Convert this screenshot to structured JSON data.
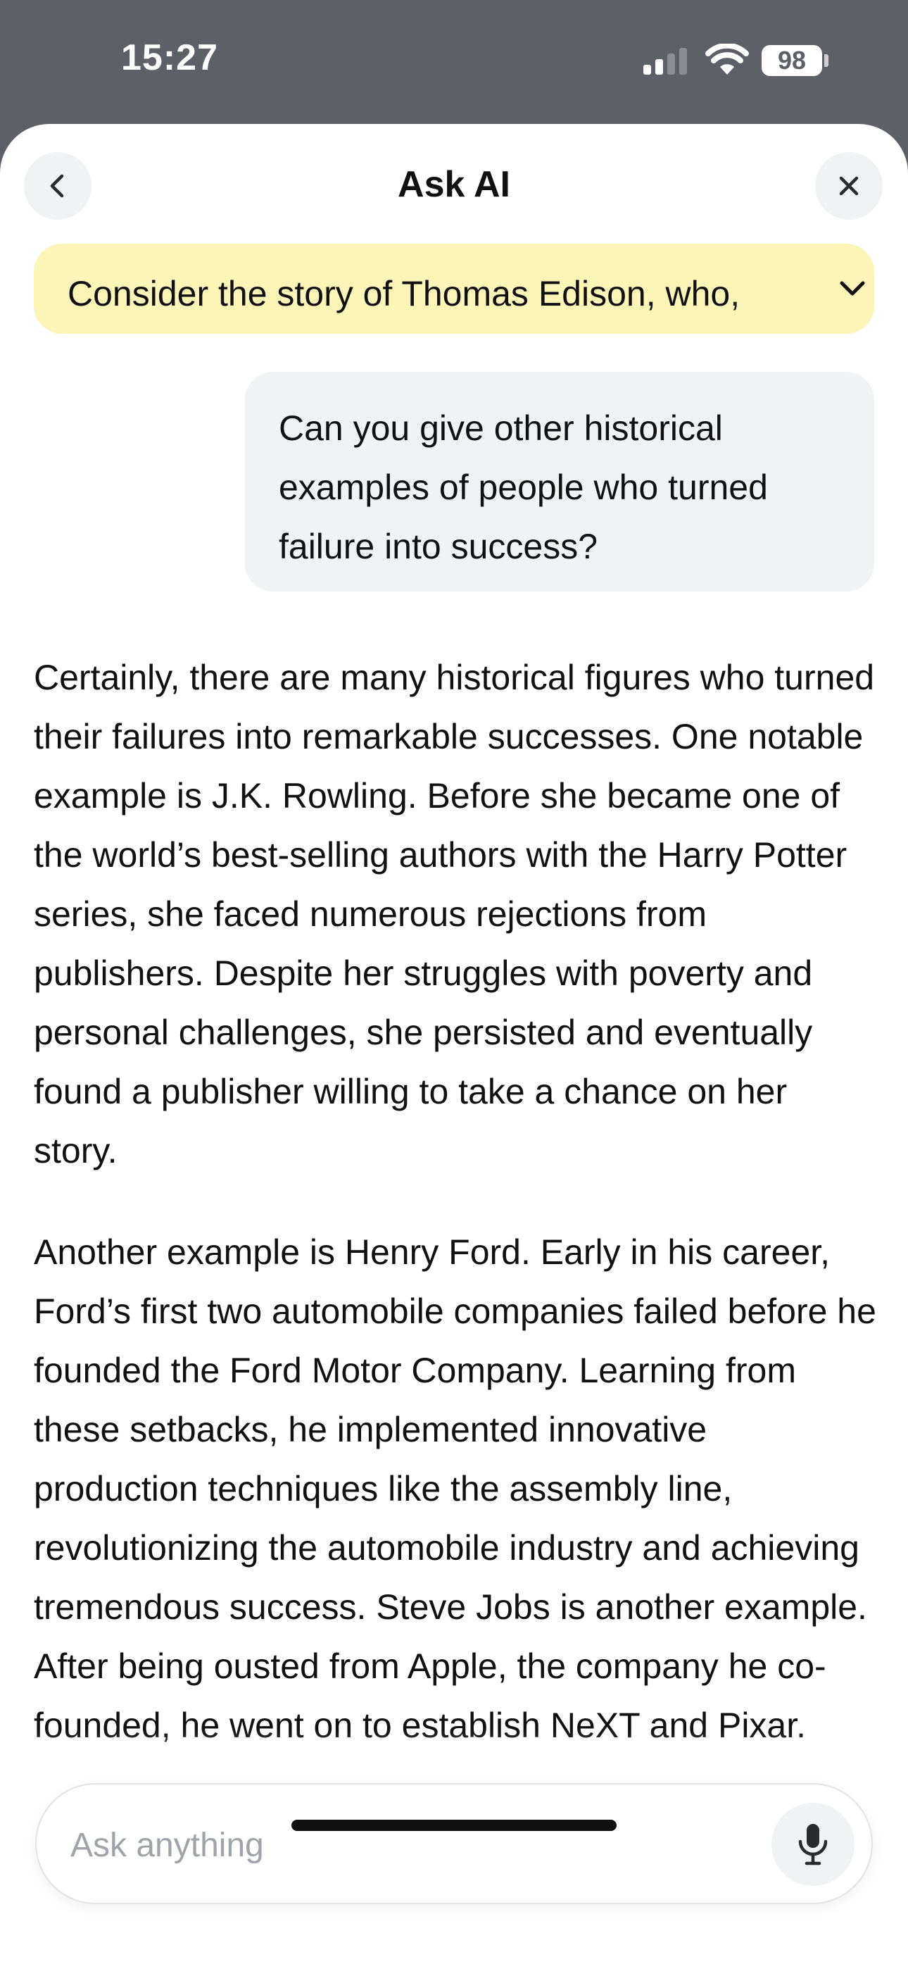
{
  "status": {
    "time": "15:27",
    "battery": "98"
  },
  "header": {
    "title": "Ask AI",
    "back_icon": "chevron-left-icon",
    "close_icon": "close-icon"
  },
  "context": {
    "text": "Consider the story of Thomas Edison, who,",
    "expand_icon": "chevron-down-icon",
    "background": "#fcf5b8"
  },
  "user_message": {
    "text": "Can you give other historical examples of people who turned failure into success?"
  },
  "assistant_message": {
    "paragraphs": [
      "Certainly, there are many historical figures who turned their failures into remarkable successes. One notable example is J.K. Rowling.  Before she became one of the world’s best-selling authors with the Harry Potter series, she faced numerous rejections from publishers.  Despite her struggles with poverty and personal challenges, she persisted and eventually found a publisher willing to take a chance on her story.",
      "Another example is Henry Ford.  Early in his career, Ford’s first two automobile companies failed before he founded the Ford Motor Company.  Learning from these setbacks, he implemented innovative production techniques like the assembly line, revolutionizing the automobile industry and achieving tremendous success. Steve Jobs is another example.  After being ousted from Apple, the company he co-founded, he went on to establish NeXT and Pixar."
    ]
  },
  "composer": {
    "placeholder": "Ask anything",
    "mic_icon": "microphone-icon"
  }
}
